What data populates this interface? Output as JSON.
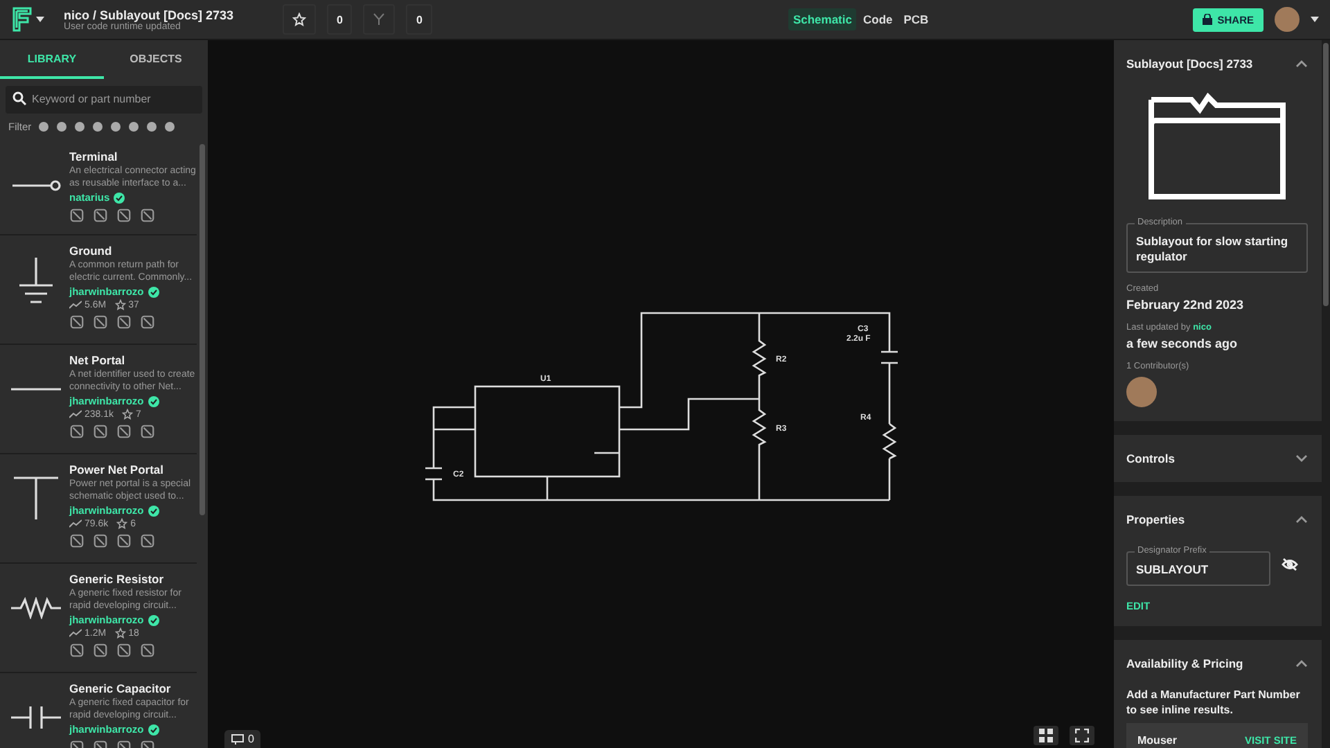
{
  "topbar": {
    "title": "nico / Sublayout [Docs] 2733",
    "subtitle": "User code runtime updated",
    "stars": "0",
    "forks": "0",
    "views": [
      {
        "label": "Schematic",
        "selected": true
      },
      {
        "label": "Code",
        "selected": false
      },
      {
        "label": "PCB",
        "selected": false
      }
    ],
    "share": "SHARE"
  },
  "sidebar": {
    "tabs": [
      {
        "label": "LIBRARY",
        "selected": true
      },
      {
        "label": "OBJECTS",
        "selected": false
      }
    ],
    "search": {
      "placeholder": "Keyword or part number"
    },
    "filter_label": "Filter",
    "items": [
      {
        "kind": "terminal",
        "name": "Terminal",
        "description": "An electrical connector acting as reusable interface to a...",
        "author": "natarius",
        "verified": true
      },
      {
        "kind": "ground",
        "name": "Ground",
        "description": "A common return path for electric current. Commonly...",
        "author": "jharwinbarrozo",
        "verified": true,
        "downloads": "5.6M",
        "stars": "37"
      },
      {
        "kind": "net",
        "name": "Net Portal",
        "description": "A net identifier used to create connectivity to other Net...",
        "author": "jharwinbarrozo",
        "verified": true,
        "downloads": "238.1k",
        "stars": "7"
      },
      {
        "kind": "power",
        "name": "Power Net Portal",
        "description": "Power net portal is a special schematic object used to...",
        "author": "jharwinbarrozo",
        "verified": true,
        "downloads": "79.6k",
        "stars": "6"
      },
      {
        "kind": "resistor",
        "name": "Generic Resistor",
        "description": "A generic fixed resistor for rapid developing circuit...",
        "author": "jharwinbarrozo",
        "verified": true,
        "downloads": "1.2M",
        "stars": "18"
      },
      {
        "kind": "capacitor",
        "name": "Generic Capacitor",
        "description": "A generic fixed capacitor for rapid developing circuit...",
        "author": "jharwinbarrozo",
        "verified": true
      }
    ]
  },
  "canvas": {
    "labels": [
      {
        "text": "U1",
        "kind": "u1"
      },
      {
        "text": "C2",
        "kind": "c2"
      },
      {
        "text": "R2",
        "kind": "r2"
      },
      {
        "text": "R3",
        "kind": "r3"
      },
      {
        "text": "C3",
        "kind": "c3"
      },
      {
        "text": "2.2u F",
        "kind": "c3v"
      },
      {
        "text": "R4",
        "kind": "r4"
      }
    ],
    "comments": "0"
  },
  "panel": {
    "title": "Sublayout [Docs] 2733",
    "expanded": true,
    "description_label": "Description",
    "description": "Sublayout for slow starting regulator",
    "created_label": "Created",
    "created": "February 22nd 2023",
    "updated_label": "Last updated by",
    "updated_by": "nico",
    "updated": "a few seconds ago",
    "contributors": "1 Contributor(s)",
    "sections": [
      {
        "title": "Controls",
        "expanded": false
      },
      {
        "kind": "properties",
        "title": "Properties",
        "expanded": true,
        "field_label": "Designator Prefix",
        "field_value": "SUBLAYOUT",
        "action": "EDIT"
      },
      {
        "kind": "pricing",
        "title": "Availability & Pricing",
        "expanded": true,
        "text": "Add a Manufacturer Part Number to see inline results.",
        "vendor": "Mouser",
        "link": "VISIT SITE"
      }
    ]
  }
}
